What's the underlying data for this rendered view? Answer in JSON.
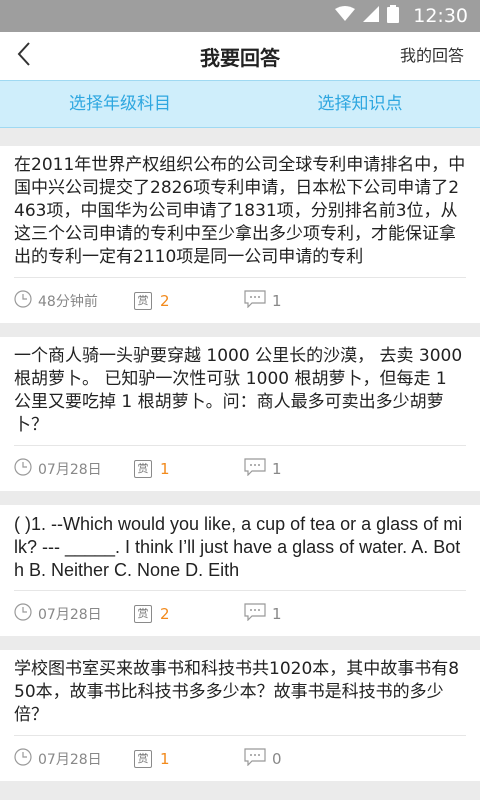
{
  "status_bar": {
    "time": "12:30",
    "icons": [
      "wifi-icon",
      "signal-icon",
      "battery-icon"
    ]
  },
  "header": {
    "title": "我要回答",
    "right_action": "我的回答",
    "back_icon": "chevron-left-icon"
  },
  "filters": [
    {
      "label": "选择年级科目"
    },
    {
      "label": "选择知识点"
    }
  ],
  "colors": {
    "accent": "#2ea7e0",
    "filter_bg": "#cfeefb",
    "reward": "#f28a1c",
    "status_bar": "#9e9e9e"
  },
  "questions": [
    {
      "text": "在2011年世界产权组织公布的公司全球专利申请排名中，中国中兴公司提交了2826项专利申请，日本松下公司申请了2463项，中国华为公司申请了1831项，分别排名前3位，从这三个公司申请的专利中至少拿出多少项专利，才能保证拿出的专利一定有2110项是同一公司申请的专利",
      "time": "48分钟前",
      "reward_label": "赏",
      "reward": "2",
      "comments": "1"
    },
    {
      "text": "一个商人骑一头驴要穿越 1000 公里长的沙漠， 去卖 3000 根胡萝卜。 已知驴一次性可驮 1000 根胡萝卜，但每走 1 公里又要吃掉 1 根胡萝卜。问：商人最多可卖出多少胡萝卜？",
      "time": "07月28日",
      "reward_label": "赏",
      "reward": "1",
      "comments": "1"
    },
    {
      "text": "( )1. --Which would you like, a cup of tea or a glass of milk? --- _____. I think I’ll just have a glass of water. A. Both B. Neither C. None D. Eith",
      "time": "07月28日",
      "reward_label": "赏",
      "reward": "2",
      "comments": "1"
    },
    {
      "text": "学校图书室买来故事书和科技书共1020本，其中故事书有850本，故事书比科技书多多少本？故事书是科技书的多少倍？",
      "time": "07月28日",
      "reward_label": "赏",
      "reward": "1",
      "comments": "0"
    }
  ]
}
